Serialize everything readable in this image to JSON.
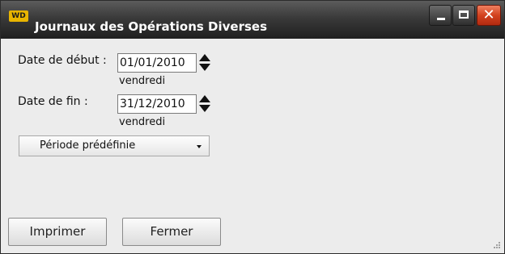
{
  "window": {
    "title": "Journaux des Opérations Diverses",
    "icon_label": "WD",
    "controls": [
      "minimize-icon",
      "maximize-icon",
      "close-icon"
    ],
    "close_color": "#d2421f"
  },
  "form": {
    "start_date": {
      "label": "Date de début :",
      "value": "01/01/2010",
      "weekday": "vendredi"
    },
    "end_date": {
      "label": "Date de fin :",
      "value": "31/12/2010",
      "weekday": "vendredi"
    },
    "period_select": {
      "selected": "Période prédéfinie"
    }
  },
  "buttons": {
    "print_label": "Imprimer",
    "close_label": "Fermer"
  }
}
